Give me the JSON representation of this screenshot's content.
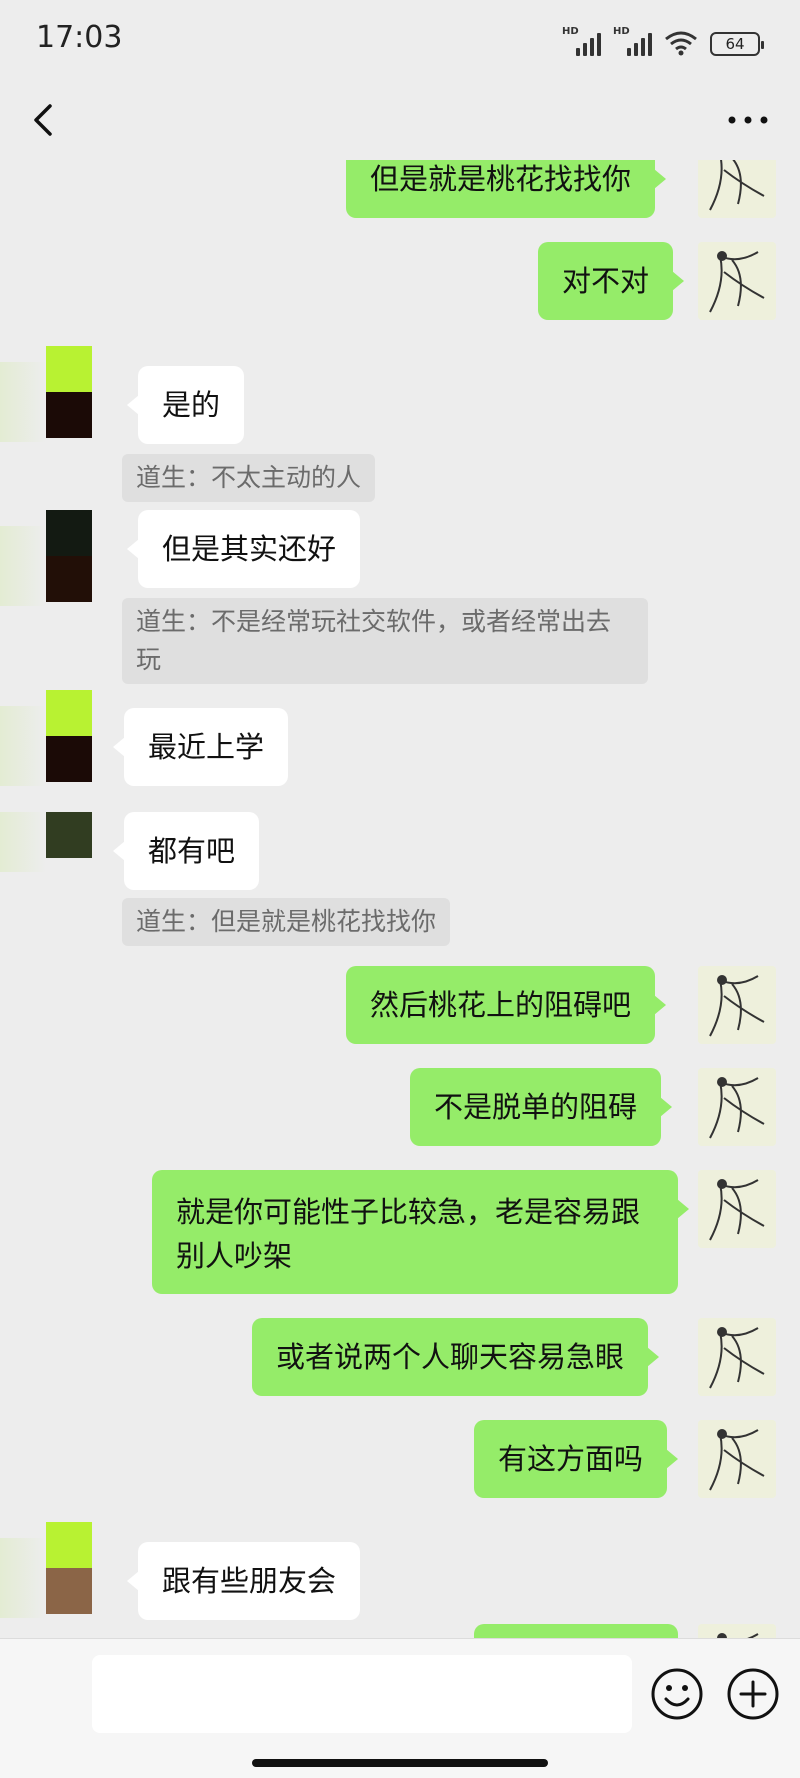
{
  "status_bar": {
    "time": "17:03",
    "network1": "HD",
    "network2": "HD",
    "battery": "64"
  },
  "icons": {
    "back": "chevron-left-icon",
    "more": "more-dots-icon",
    "emoji": "smiley-face-icon",
    "plus": "plus-circle-icon"
  },
  "colors": {
    "my_bubble": "#95ec69",
    "their_bubble": "#ffffff",
    "background": "#ededed",
    "quote_bg": "#dfdfdf"
  },
  "messages": [
    {
      "sender": "me",
      "text": "但是就是桃花找找你"
    },
    {
      "sender": "me",
      "text": "对不对"
    },
    {
      "sender": "other",
      "text": "是的",
      "quote": "道生：不太主动的人"
    },
    {
      "sender": "other",
      "text": "但是其实还好",
      "quote": "道生：不是经常玩社交软件，或者经常出去玩"
    },
    {
      "sender": "other",
      "text": "最近上学"
    },
    {
      "sender": "other",
      "text": "都有吧",
      "quote": "道生：但是就是桃花找找你"
    },
    {
      "sender": "me",
      "text": "然后桃花上的阻碍吧"
    },
    {
      "sender": "me",
      "text": "不是脱单的阻碍"
    },
    {
      "sender": "me",
      "text": "就是你可能性子比较急，老是容易跟别人吵架"
    },
    {
      "sender": "me",
      "text": "或者说两个人聊天容易急眼"
    },
    {
      "sender": "me",
      "text": "有这方面吗"
    },
    {
      "sender": "other",
      "text": "跟有些朋友会"
    }
  ],
  "input": {
    "value": "",
    "placeholder": ""
  }
}
